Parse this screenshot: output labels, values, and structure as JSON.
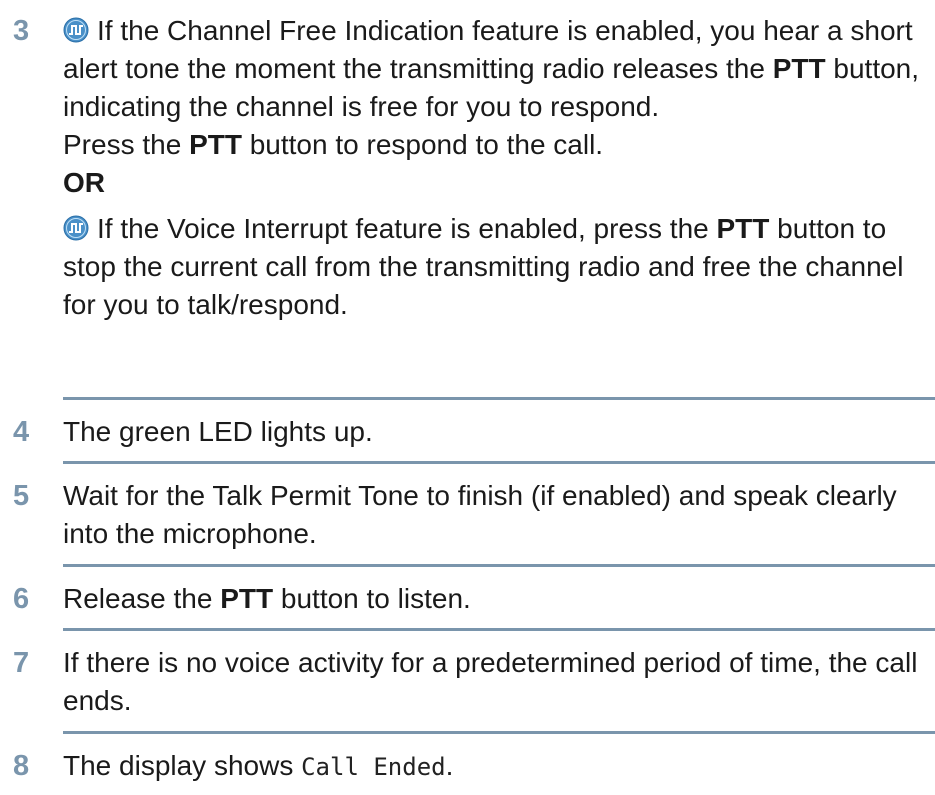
{
  "steps": [
    {
      "number": "3",
      "icon": "feature-wave-icon",
      "p1_a": "If the Channel Free Indication feature is enabled, you hear a short alert tone the moment the transmitting radio releases the ",
      "p1_bold": "PTT",
      "p1_b": " button, indicating the channel is free for you to respond.",
      "p2_a": "Press the ",
      "p2_bold": "PTT",
      "p2_b": " button to respond to the call.",
      "or": "OR",
      "p3_a": "If the Voice Interrupt feature is enabled, press the ",
      "p3_bold": "PTT",
      "p3_b": " button to stop the current call from the transmitting radio and free the channel for you to talk/respond."
    },
    {
      "number": "4",
      "text": "The green LED lights up."
    },
    {
      "number": "5",
      "text": "Wait for the Talk Permit Tone to finish (if enabled) and speak clearly into the microphone."
    },
    {
      "number": "6",
      "text_a": "Release the ",
      "bold": "PTT",
      "text_b": " button to listen."
    },
    {
      "number": "7",
      "text": "If there is no voice activity for a predetermined period of time, the call ends."
    },
    {
      "number": "8",
      "text_a": "The display shows ",
      "mono": "Call Ended",
      "text_b": "."
    }
  ],
  "colors": {
    "accent": "#7a95ac",
    "icon_fill": "#4a90c8"
  }
}
